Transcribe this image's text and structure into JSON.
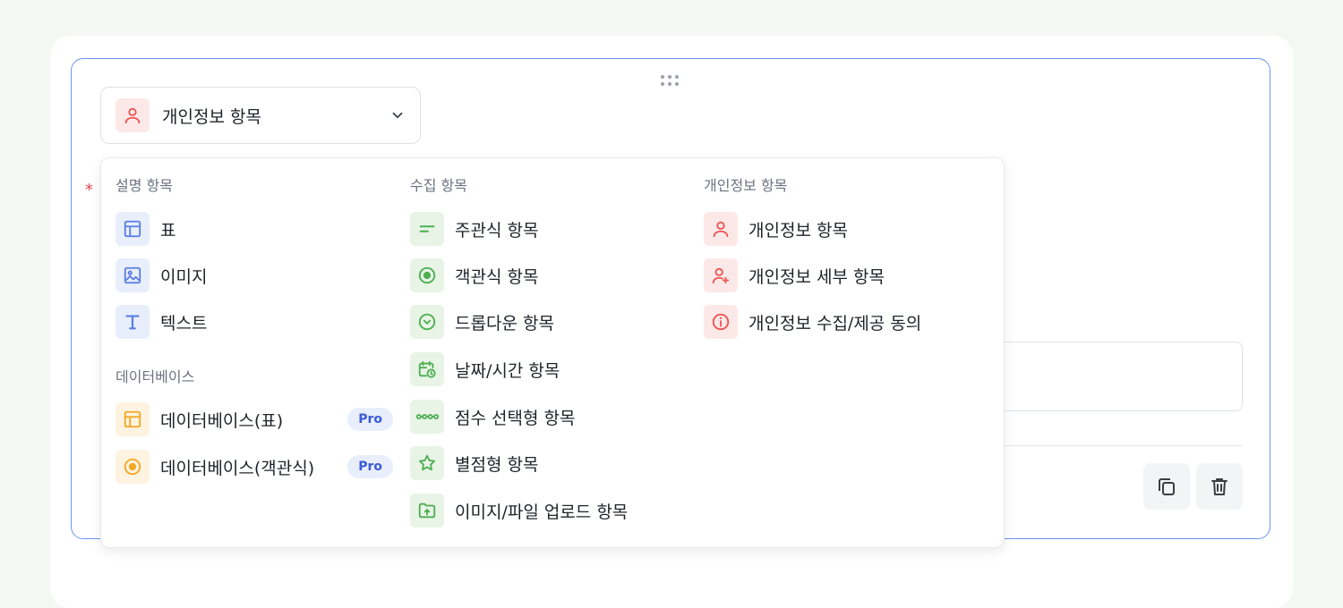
{
  "type_select": {
    "label": "개인정보 항목",
    "icon": "person-icon"
  },
  "required_mark": "*",
  "dropdown": {
    "columns": [
      {
        "sections": [
          {
            "title": "설명 항목",
            "items": [
              {
                "label": "표",
                "icon": "table-icon"
              },
              {
                "label": "이미지",
                "icon": "image-icon"
              },
              {
                "label": "텍스트",
                "icon": "text-icon"
              }
            ]
          },
          {
            "title": "데이터베이스",
            "items": [
              {
                "label": "데이터베이스(표)",
                "icon": "database-table-icon",
                "badge": "Pro"
              },
              {
                "label": "데이터베이스(객관식)",
                "icon": "database-choice-icon",
                "badge": "Pro"
              }
            ]
          }
        ]
      },
      {
        "sections": [
          {
            "title": "수집 항목",
            "items": [
              {
                "label": "주관식 항목",
                "icon": "short-text-icon"
              },
              {
                "label": "객관식 항목",
                "icon": "radio-icon"
              },
              {
                "label": "드롭다운 항목",
                "icon": "dropdown-icon"
              },
              {
                "label": "날짜/시간 항목",
                "icon": "calendar-clock-icon"
              },
              {
                "label": "점수 선택형 항목",
                "icon": "scale-icon"
              },
              {
                "label": "별점형 항목",
                "icon": "star-icon"
              },
              {
                "label": "이미지/파일 업로드 항목",
                "icon": "upload-icon"
              }
            ]
          }
        ]
      },
      {
        "sections": [
          {
            "title": "개인정보 항목",
            "items": [
              {
                "label": "개인정보 항목",
                "icon": "person-icon"
              },
              {
                "label": "개인정보 세부 항목",
                "icon": "person-add-icon"
              },
              {
                "label": "개인정보 수집/제공 동의",
                "icon": "info-icon"
              }
            ]
          }
        ]
      }
    ]
  },
  "actions": {
    "copy_icon": "copy-icon",
    "delete_icon": "trash-icon"
  },
  "colors": {
    "accent_blue": "#5b7ee5",
    "accent_green": "#4caf50",
    "accent_red": "#ef5350",
    "accent_yellow": "#f5a623",
    "card_border": "#6a93ee"
  }
}
